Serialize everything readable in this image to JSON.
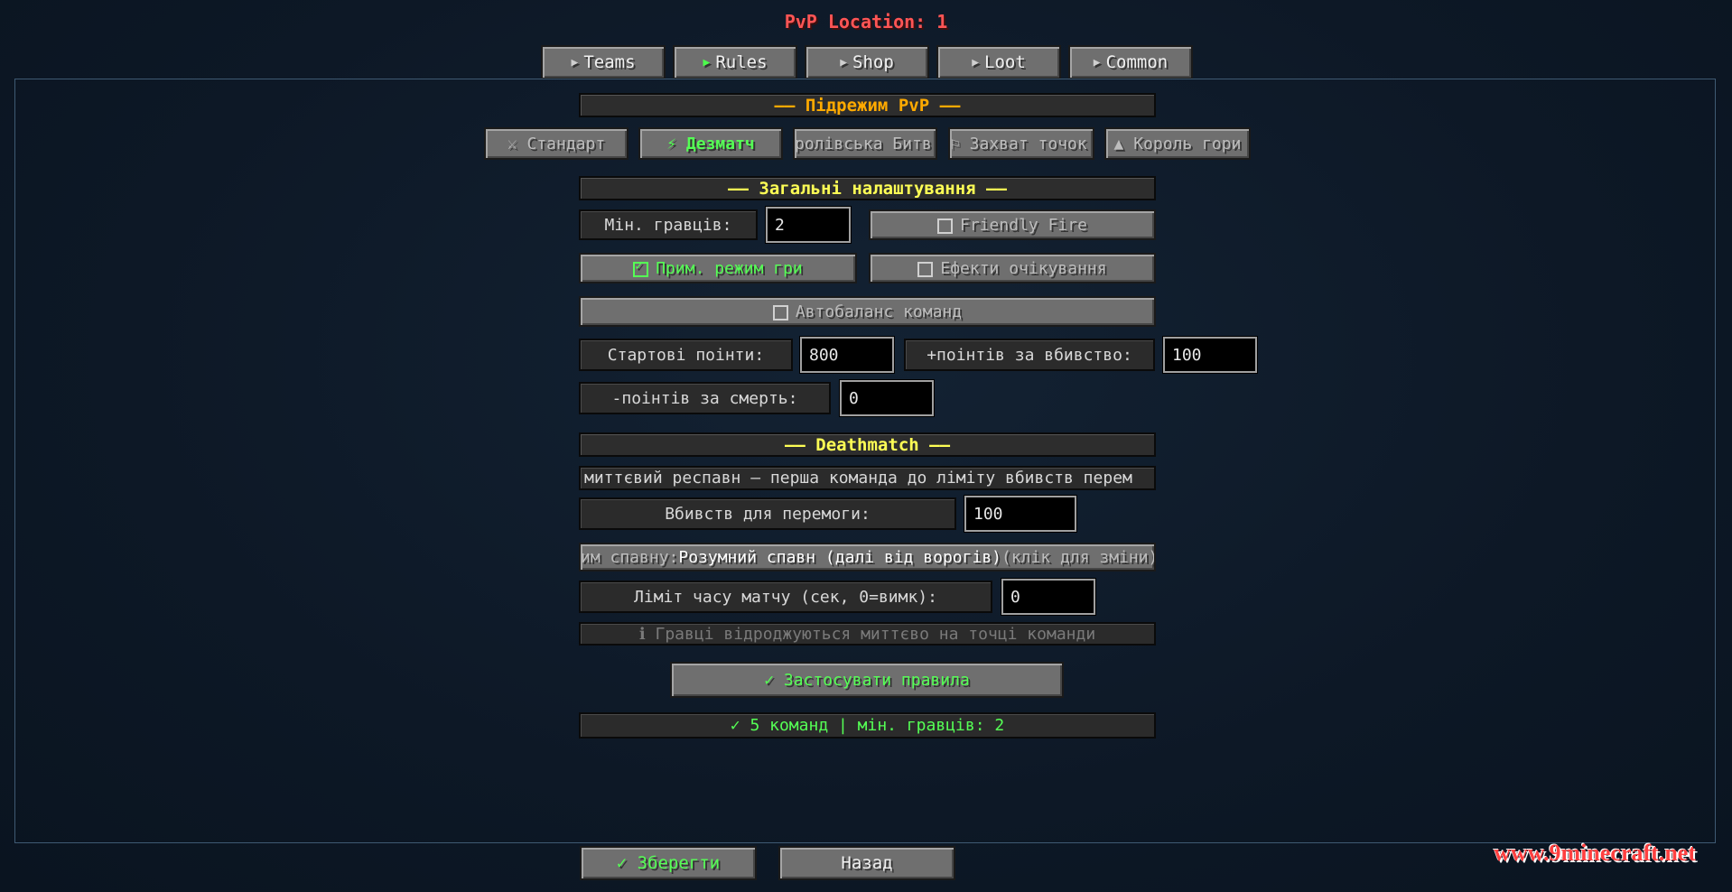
{
  "title": "PvP Location: 1",
  "tabs": [
    {
      "label": "Teams",
      "icon": "play-arrow-icon"
    },
    {
      "label": "Rules",
      "icon": "play-arrow-icon",
      "active": true
    },
    {
      "label": "Shop",
      "icon": "play-arrow-icon"
    },
    {
      "label": "Loot",
      "icon": "play-arrow-icon"
    },
    {
      "label": "Common",
      "icon": "play-arrow-icon"
    }
  ],
  "submode": {
    "header": "—— Підрежим PvP ——",
    "buttons": [
      "⚔ Стандарт",
      "⚡ Дезматч",
      "ролівська Битв",
      "⚐ Захват точок",
      "▲ Король гори"
    ],
    "selected": "⚡ Дезматч"
  },
  "general": {
    "header": "—— Загальні налаштування ——",
    "min_players_label": "Мін. гравців:",
    "min_players_value": "2",
    "friendly_fire": {
      "label": "Friendly Fire",
      "checked": false
    },
    "force_gamemode": {
      "label": "Прим. режим гри",
      "checked": true
    },
    "wait_effects": {
      "label": "Ефекти очікування",
      "checked": false
    },
    "autobalance": {
      "label": "Автобаланс команд",
      "checked": false
    },
    "start_points_label": "Стартові поінти:",
    "start_points_value": "800",
    "kill_points_label": "+поінтів за вбивство:",
    "kill_points_value": "100",
    "death_points_label": "-поінтів за смерть:",
    "death_points_value": "0"
  },
  "deathmatch": {
    "header": "—— Deathmatch ——",
    "description": "миттєвий респавн — перша команда до ліміту вбивств перем",
    "kills_to_win_label": "Вбивств для перемоги:",
    "kills_to_win_value": "100",
    "spawn_mode_prefix": "им спавну: ",
    "spawn_mode_value": "Розумний спавн (далі від ворогів)",
    "spawn_mode_hint": " (клік для зміни)",
    "time_limit_label": "Ліміт часу матчу (сек, 0=вимк):",
    "time_limit_value": "0",
    "info": "ℹ Гравці відроджуються миттєво на точці команди"
  },
  "apply_label": "✓ Застосувати правила",
  "status": "✓ 5 команд | мін. гравців: 2",
  "footer": {
    "save_label": "✓ Зберегти",
    "back_label": "Назад"
  },
  "watermark": "www.9minecraft.net",
  "colors": {
    "accent_green": "#55ff55",
    "header_yellow": "#ffff55",
    "header_orange": "#ffaa00",
    "title_red": "#ff5555"
  }
}
